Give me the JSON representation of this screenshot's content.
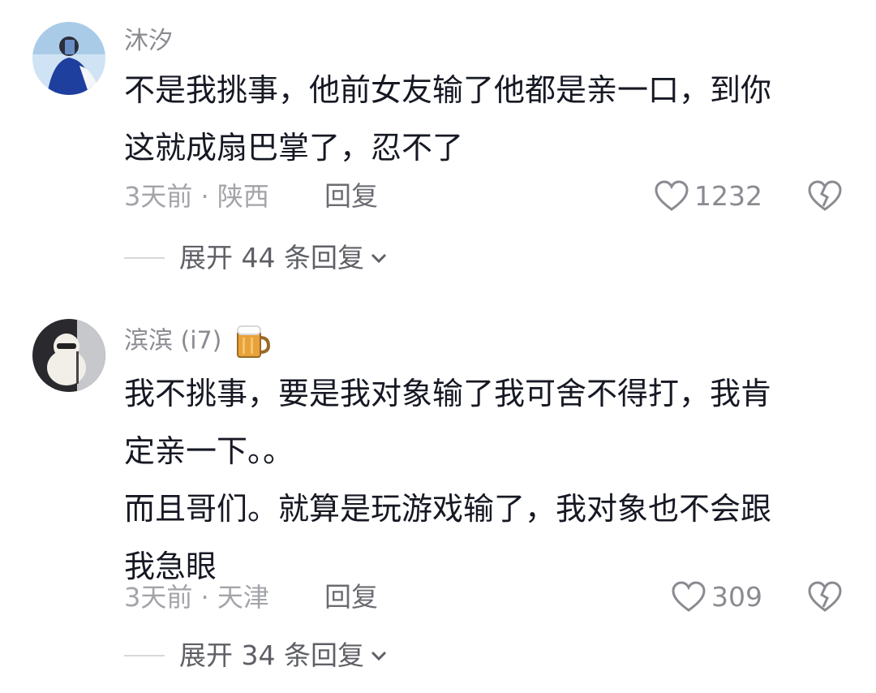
{
  "comments": [
    {
      "username": "沐汐",
      "lines": [
        "不是我挑事，他前女友输了他都是亲一口，到你",
        "这就成扇巴掌了，忍不了"
      ],
      "time_location": "3天前 · 陕西",
      "reply_label": "回复",
      "likes": "1232",
      "expand_label": "展开 44 条回复"
    },
    {
      "username": "滨滨 (i7)",
      "lines": [
        "我不挑事，要是我对象输了我可舍不得打，我肯",
        "定亲一下。。",
        "而且哥们。就算是玩游戏输了，我对象也不会跟",
        "我急眼"
      ],
      "time_location": "3天前 · 天津",
      "reply_label": "回复",
      "likes": "309",
      "expand_label": "展开 34 条回复"
    }
  ],
  "colors": {
    "text": "#161823",
    "muted": "#a3a4a9",
    "username": "#8a8b91"
  }
}
